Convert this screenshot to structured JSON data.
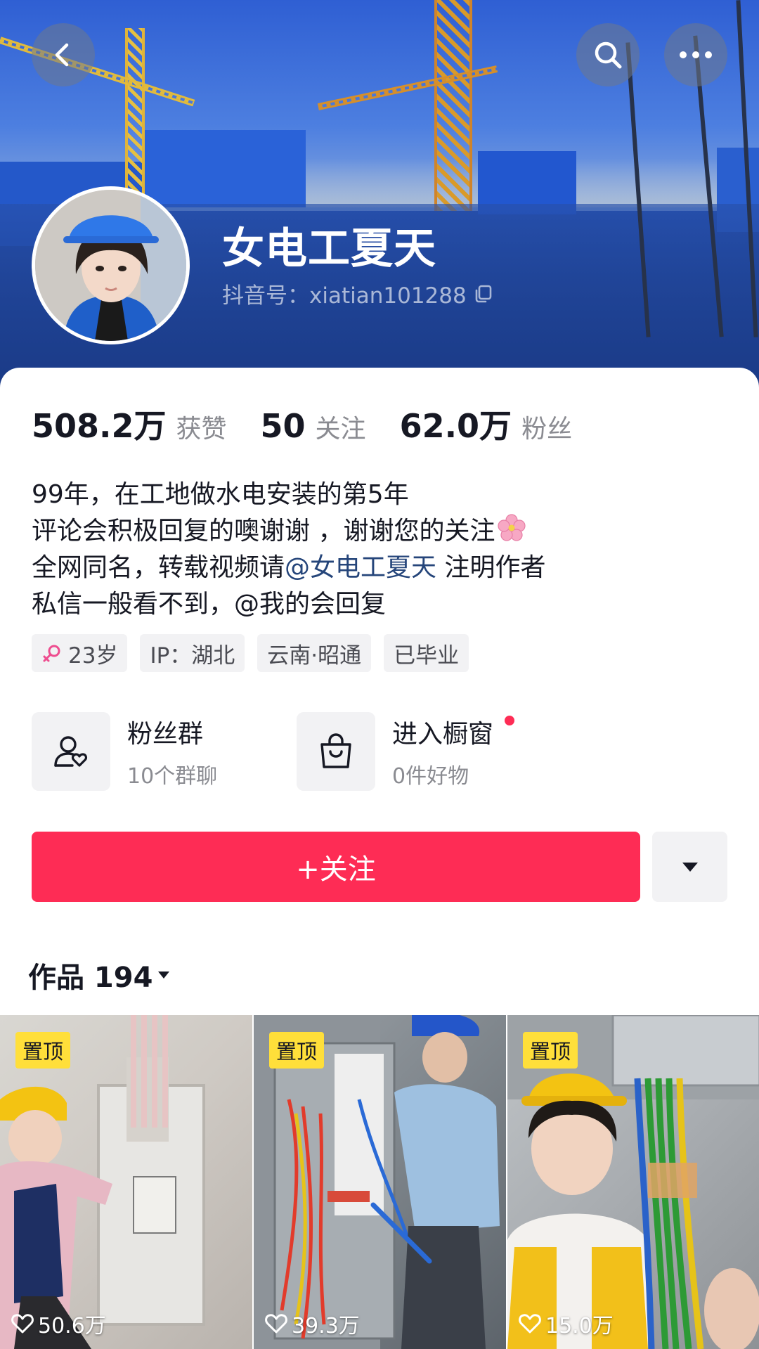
{
  "header": {
    "back_icon": "chevron-left-icon",
    "search_icon": "search-icon",
    "more_icon": "more-horizontal-icon"
  },
  "profile": {
    "username": "女电工夏天",
    "douyin_id": "抖音号：xiatian101288",
    "copy_icon": "copy-icon"
  },
  "stats": [
    {
      "value": "508.2万",
      "label": "获赞"
    },
    {
      "value": "50",
      "label": "关注"
    },
    {
      "value": "62.0万",
      "label": "粉丝"
    }
  ],
  "bio": {
    "line1": "99年，在工地做水电安装的第5年",
    "line2": "评论会积极回复的噢谢谢 ，谢谢您的关注",
    "line3_prefix": "全网同名，转载视频请",
    "line3_mention": "@女电工夏天",
    "line3_suffix": " 注明作者",
    "line4": "私信一般看不到，@我的会回复"
  },
  "tags": [
    {
      "label": "23岁",
      "icon": "female-icon"
    },
    {
      "label": "IP：湖北"
    },
    {
      "label": "云南·昭通"
    },
    {
      "label": "已毕业"
    }
  ],
  "entries": {
    "fans_group": {
      "title": "粉丝群",
      "subtitle": "10个群聊",
      "icon": "fan-group-icon"
    },
    "shop_window": {
      "title": "进入橱窗",
      "subtitle": "0件好物",
      "icon": "shopping-bag-icon"
    }
  },
  "follow": {
    "label": "+关注",
    "more_icon": "caret-down-icon"
  },
  "works": {
    "title": "作品 194"
  },
  "videos": [
    {
      "pinned": "置顶",
      "likes": "50.6万"
    },
    {
      "pinned": "置顶",
      "likes": "39.3万"
    },
    {
      "pinned": "置顶",
      "likes": "15.0万"
    }
  ],
  "colors": {
    "accent": "#fe2c55",
    "pin_badge": "#ffdf3a",
    "mention": "#25457a",
    "muted_text": "#8a8b91"
  }
}
